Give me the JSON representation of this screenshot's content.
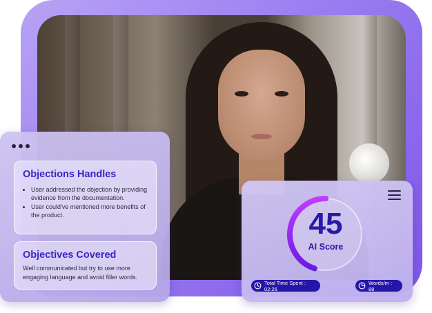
{
  "objections": {
    "title": "Objections Handles",
    "items": [
      "User addressed the objection by providing evidence from the documentation.",
      "User could've mentioned more benefits of the product."
    ]
  },
  "objectives": {
    "title": "Objectives Covered",
    "text": "Well communicated but try to use more engaging language and avoid filler words."
  },
  "score": {
    "value": "45",
    "label": "AI Score",
    "progress": 0.45
  },
  "stats": {
    "time_spent": "Total Time Spent : 02:26",
    "words_per_min": "Words/m : 88"
  },
  "colors": {
    "accent": "#2a1aa8",
    "gauge_start": "#c23bff",
    "gauge_end": "#6a1ce0",
    "frame": "#9b7cf0"
  },
  "icons": {
    "menu": "hamburger-menu-icon",
    "clock": "clock-icon",
    "chart": "pie-chart-icon",
    "more": "more-dots-icon"
  }
}
